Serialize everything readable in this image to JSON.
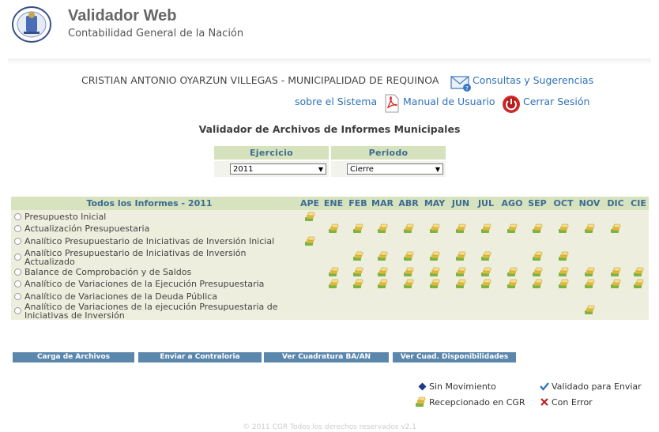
{
  "header": {
    "title": "Validador Web",
    "subtitle": "Contabilidad General de la Nación"
  },
  "user_line": "CRISTIAN ANTONIO OYARZUN VILLEGAS - MUNICIPALIDAD DE REQUINOA",
  "links": {
    "consultas": "Consultas y Sugerencias",
    "sobre": "sobre el Sistema",
    "manual": "Manual de Usuario",
    "cerrar": "Cerrar Sesión"
  },
  "section_title": "Validador de Archivos de Informes Municipales",
  "selectors": {
    "ejercicio_label": "Ejercicio",
    "ejercicio_value": "2011",
    "periodo_label": "Periodo",
    "periodo_value": "Cierre"
  },
  "table": {
    "title": "Todos los Informes - 2011",
    "months": [
      "APE",
      "ENE",
      "FEB",
      "MAR",
      "ABR",
      "MAY",
      "JUN",
      "JUL",
      "AGO",
      "SEP",
      "OCT",
      "NOV",
      "DIC",
      "CIE"
    ],
    "rows": [
      {
        "label": "Presupuesto Inicial",
        "status": [
          1,
          0,
          0,
          0,
          0,
          0,
          0,
          0,
          0,
          0,
          0,
          0,
          0,
          0
        ]
      },
      {
        "label": "Actualización Presupuestaria",
        "status": [
          0,
          1,
          1,
          1,
          1,
          1,
          1,
          1,
          1,
          1,
          1,
          1,
          1,
          0
        ]
      },
      {
        "label": "Analítico Presupuestario de Iniciativas de Inversión Inicial",
        "status": [
          1,
          0,
          0,
          0,
          0,
          0,
          0,
          0,
          0,
          0,
          0,
          0,
          0,
          0
        ]
      },
      {
        "label": "Analítico Presupuestario de Iniciativas de Inversión",
        "label2": "Actualizado",
        "status": [
          0,
          0,
          1,
          1,
          1,
          1,
          1,
          1,
          0,
          1,
          1,
          0,
          0,
          0
        ]
      },
      {
        "label": "Balance de Comprobación y de Saldos",
        "status": [
          0,
          1,
          1,
          1,
          1,
          1,
          1,
          1,
          1,
          1,
          1,
          1,
          1,
          1
        ]
      },
      {
        "label": "Analítico de Variaciones de la Ejecución Presupuestaria",
        "status": [
          0,
          1,
          1,
          1,
          1,
          1,
          1,
          1,
          1,
          1,
          1,
          1,
          1,
          1
        ]
      },
      {
        "label": "Analítico de Variaciones de la Deuda Pública",
        "status": [
          0,
          0,
          0,
          0,
          0,
          0,
          0,
          0,
          0,
          0,
          0,
          0,
          0,
          0
        ]
      },
      {
        "label": "Analítico de Variaciones de la ejecución Presupuestaria de",
        "label2": "Iniciativas de Inversión",
        "status": [
          0,
          0,
          0,
          0,
          0,
          0,
          0,
          0,
          0,
          0,
          0,
          1,
          0,
          0
        ]
      }
    ]
  },
  "buttons": {
    "carga": "Carga de Archivos",
    "enviar": "Enviar a Contraloria",
    "cuadratura": "Ver Cuadratura BA/AN",
    "disponibilidades": "Ver Cuad. Disponibilidades"
  },
  "legend": {
    "sin_movimiento": "Sin Movimiento",
    "validado": "Validado para Enviar",
    "recepcionado": "Recepcionado en CGR",
    "con_error": "Con Error"
  },
  "footer": "© 2011 CGR Todos los derechos reservados v2.1",
  "colors": {
    "header_band": "#d7e2be",
    "button_blue": "#5b87ad",
    "link_blue": "#2f72b8"
  }
}
